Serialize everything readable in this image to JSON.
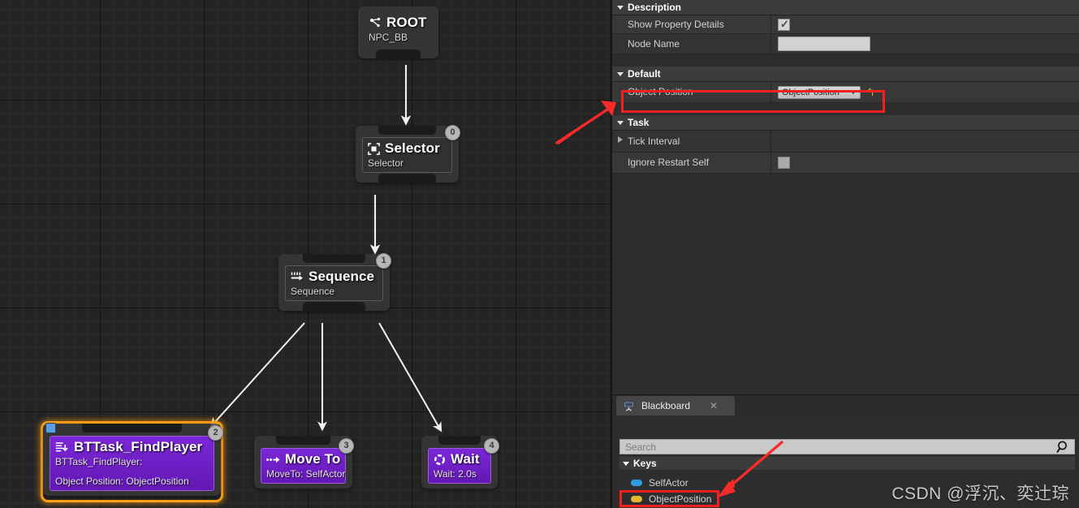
{
  "graph": {
    "nodes": [
      {
        "id": "root",
        "title": "ROOT",
        "subtitle": "NPC_BB",
        "index": "",
        "icon": "root-graph-icon"
      },
      {
        "id": "selector",
        "title": "Selector",
        "subtitle": "Selector",
        "index": "0",
        "icon": "selector-icon"
      },
      {
        "id": "sequence",
        "title": "Sequence",
        "subtitle": "Sequence",
        "index": "1",
        "icon": "sequence-icon"
      },
      {
        "id": "bttask",
        "title": "BTTask_FindPlayer",
        "subtitle": "BTTask_FindPlayer:",
        "detail": "Object Position: ObjectPosition",
        "index": "2",
        "icon": "task-list-icon"
      },
      {
        "id": "moveto",
        "title": "Move To",
        "subtitle": "MoveTo: SelfActor",
        "index": "3",
        "icon": "move-to-icon"
      },
      {
        "id": "wait",
        "title": "Wait",
        "subtitle": "Wait: 2.0s",
        "index": "4",
        "icon": "wait-clock-icon"
      }
    ]
  },
  "details": {
    "description": {
      "header": "Description",
      "rows": [
        {
          "label": "Show Property Details",
          "control": "checkbox",
          "checked": true
        },
        {
          "label": "Node Name",
          "control": "text",
          "value": ""
        }
      ]
    },
    "default": {
      "header": "Default",
      "rows": [
        {
          "label": "Object Position",
          "control": "combo",
          "value": "ObjectPosition",
          "reset": "↰"
        }
      ]
    },
    "task": {
      "header": "Task",
      "rows": [
        {
          "label": "Tick Interval",
          "control": "expander",
          "value": ""
        },
        {
          "label": "Ignore Restart Self",
          "control": "checkbox",
          "checked": false
        }
      ]
    }
  },
  "blackboard": {
    "tab_label": "Blackboard",
    "tab_close": "✕",
    "tab_icon": "blackboard-icon",
    "search_placeholder": "Search",
    "search_value": "",
    "search_icon": "search-magnifier-icon",
    "keys_header": "Keys",
    "keys": [
      {
        "label": "SelfActor",
        "color": "#2e9bdc"
      },
      {
        "label": "ObjectPosition",
        "color": "#e3b62b"
      }
    ]
  },
  "watermark": "CSDN @浮沉、奕辻琮",
  "colors": {
    "accent_selection": "#ffa114",
    "annotation_red": "#f32020",
    "task_purple": "#6f21c8",
    "key_actor_blue": "#2e9bdc",
    "key_vector_yellow": "#e3b62b"
  }
}
